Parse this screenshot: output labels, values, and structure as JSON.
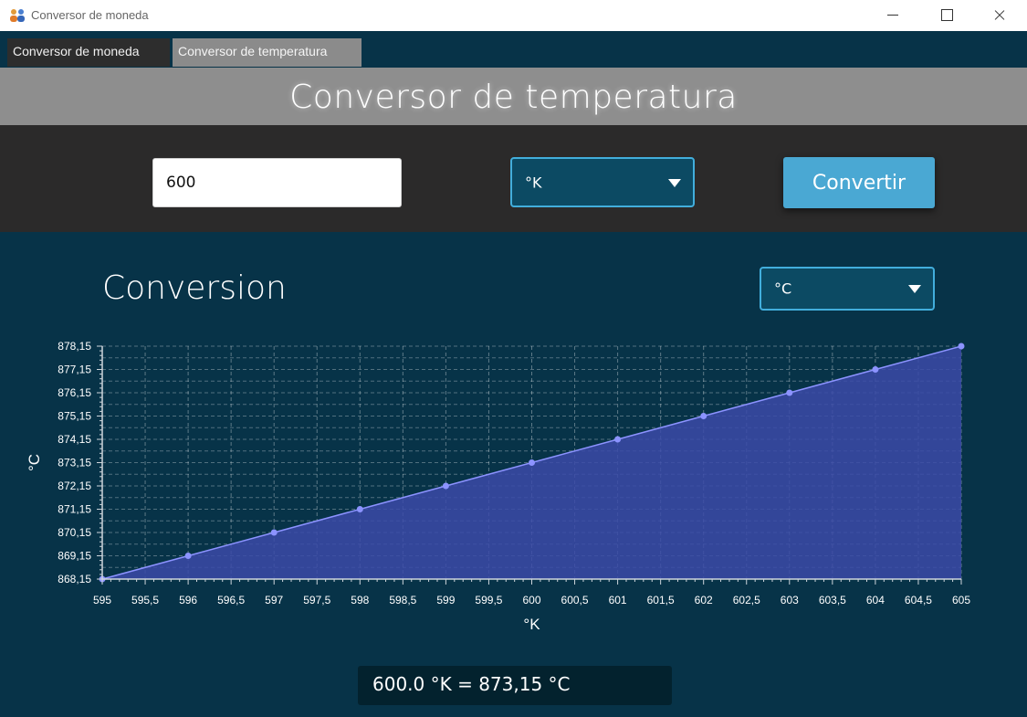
{
  "window": {
    "title": "Conversor de moneda",
    "icon": "people-icon"
  },
  "tabs": [
    {
      "label": "Conversor de moneda",
      "selected": false
    },
    {
      "label": "Conversor de temperatura",
      "selected": true
    }
  ],
  "header": {
    "title": "Conversor de temperatura"
  },
  "form": {
    "input_value": "600",
    "from_unit": "°K",
    "convert_label": "Convertir"
  },
  "conversion": {
    "heading": "Conversion",
    "to_unit": "°C",
    "result": "600.0 °K = 873,15 °C"
  },
  "colors": {
    "accent": "#42aedc",
    "area_fill": "#3b4aa8",
    "line": "#8c93ff",
    "background": "#073348"
  },
  "chart_data": {
    "type": "area",
    "xlabel": "°K",
    "ylabel": "°C",
    "xlim": [
      595,
      605
    ],
    "ylim": [
      868.15,
      878.15
    ],
    "x_ticks": [
      "595",
      "595,5",
      "596",
      "596,5",
      "597",
      "597,5",
      "598",
      "598,5",
      "599",
      "599,5",
      "600",
      "600,5",
      "601",
      "601,5",
      "602",
      "602,5",
      "603",
      "603,5",
      "604",
      "604,5",
      "605"
    ],
    "y_ticks": [
      "868,15",
      "869,15",
      "870,15",
      "871,15",
      "872,15",
      "873,15",
      "874,15",
      "875,15",
      "876,15",
      "877,15",
      "878,15"
    ],
    "grid": true,
    "series": [
      {
        "x": [
          595,
          596,
          597,
          598,
          599,
          600,
          601,
          602,
          603,
          604,
          605
        ],
        "y": [
          868.15,
          869.15,
          870.15,
          871.15,
          872.15,
          873.15,
          874.15,
          875.15,
          876.15,
          877.15,
          878.15
        ]
      }
    ]
  }
}
